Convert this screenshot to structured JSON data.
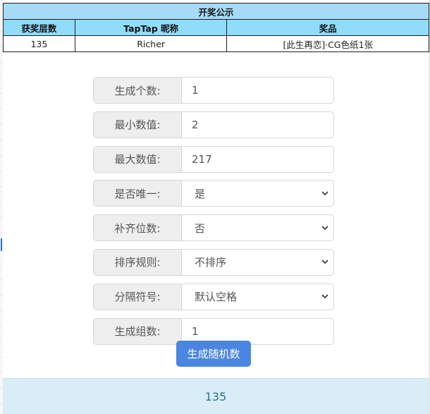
{
  "award_table": {
    "title": "开奖公示",
    "headers": [
      "获奖层数",
      "TapTap 昵称",
      "奖品"
    ],
    "rows": [
      [
        "135",
        "Richer",
        "[此生再恋]·CG色纸1张"
      ]
    ]
  },
  "form": {
    "count": {
      "label": "生成个数:",
      "value": "1"
    },
    "min": {
      "label": "最小数值:",
      "value": "2"
    },
    "max": {
      "label": "最大数值:",
      "value": "217"
    },
    "unique": {
      "label": "是否唯一:",
      "value": "是"
    },
    "pad": {
      "label": "补齐位数:",
      "value": "否"
    },
    "sort": {
      "label": "排序规则:",
      "value": "不排序"
    },
    "separator": {
      "label": "分隔符号:",
      "value": "默认空格"
    },
    "groups": {
      "label": "生成组数:",
      "value": "1"
    }
  },
  "generate_button": "生成随机数",
  "result": "135",
  "colors": {
    "title_bg": "#a7dbf5",
    "header_bg": "#8fdcfb",
    "button_bg": "#4a86e0",
    "result_bg": "#d9edf7",
    "result_text": "#31708f"
  },
  "icons": {
    "select_arrow": "chevron-down-icon"
  }
}
